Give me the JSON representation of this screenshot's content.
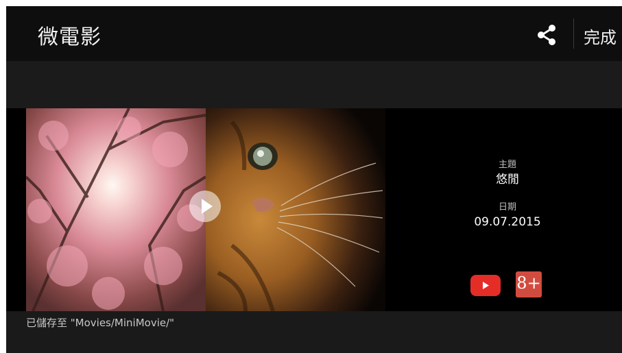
{
  "app": {
    "title": "微電影",
    "done_label": "完成"
  },
  "icons": {
    "share": "share-icon",
    "play": "play-icon",
    "youtube": "youtube-icon",
    "gplus": "google-plus-icon"
  },
  "details": {
    "theme_label": "主題",
    "theme_value": "悠閒",
    "date_label": "日期",
    "date_value": "09.07.2015"
  },
  "social": {
    "gplus_text": "8+"
  },
  "status": {
    "saved_text": "已儲存至 \"Movies/MiniMovie/\""
  },
  "colors": {
    "youtube": "#e52d27",
    "gplus": "#d14c3f",
    "background": "#1a1a1a"
  }
}
